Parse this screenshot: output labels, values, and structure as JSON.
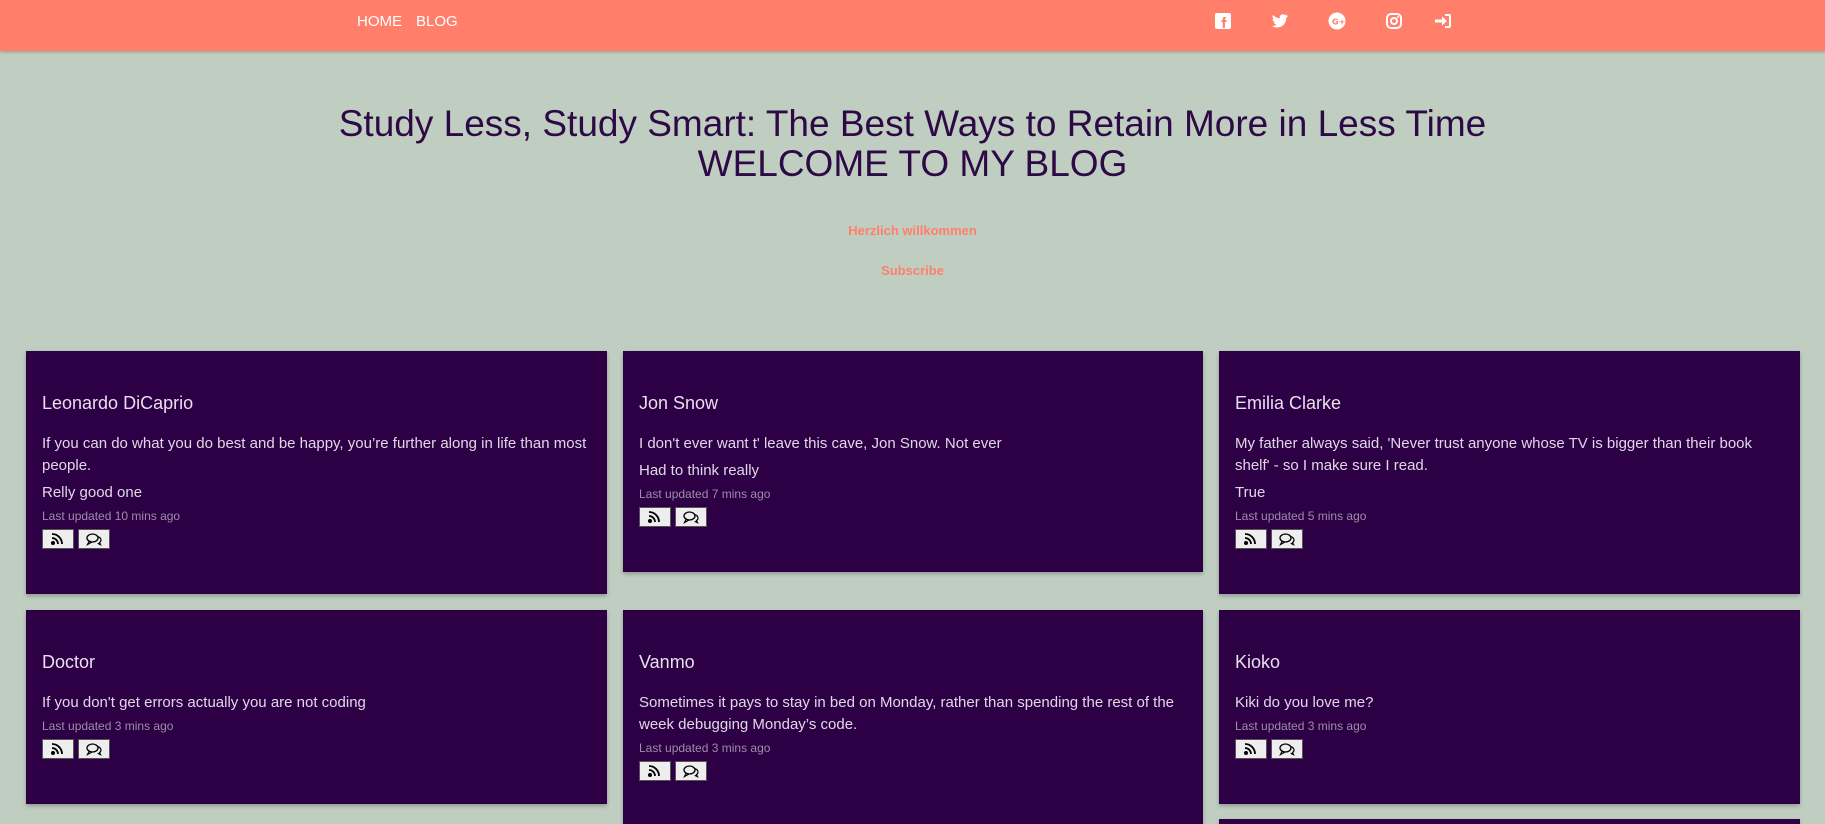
{
  "nav": {
    "links": [
      "HOME",
      "BLOG"
    ],
    "icons": [
      "facebook-icon",
      "twitter-icon",
      "google-plus-icon",
      "instagram-icon",
      "sign-in-icon"
    ]
  },
  "hero": {
    "title_line1": "Study Less, Study Smart: The Best Ways to Retain More in Less Time",
    "title_line2": "WELCOME TO MY BLOG",
    "greeting": "Herzlich willkommen",
    "subscribe": "Subscribe"
  },
  "posts": [
    {
      "title": "Leonardo DiCaprio",
      "text": "If you can do what you do best and be happy, you’re further along in life than most people.",
      "comment": "Relly good one",
      "updated": "Last updated 10 mins ago"
    },
    {
      "title": "Jon Snow",
      "text": "I don't ever want t' leave this cave, Jon Snow. Not ever",
      "comment": "Had to think really",
      "updated": "Last updated 7 mins ago"
    },
    {
      "title": "Emilia Clarke",
      "text": "My father always said, 'Never trust anyone whose TV is bigger than their book shelf' - so I make sure I read.",
      "comment": "True",
      "updated": "Last updated 5 mins ago"
    },
    {
      "title": "Doctor",
      "text": "If you don't get errors actually you are not coding",
      "comment": "",
      "updated": "Last updated 3 mins ago"
    },
    {
      "title": "Vanmo",
      "text": "Sometimes it pays to stay in bed on Monday, rather than spending the rest of the week debugging Monday’s code.",
      "comment": "",
      "updated": "Last updated 3 mins ago"
    },
    {
      "title": "Kioko",
      "text": "Kiki do you love me?",
      "comment": "",
      "updated": "Last updated 3 mins ago"
    }
  ],
  "colors": {
    "navbar": "#ff7f6a",
    "background": "#c0cec2",
    "card": "#2d0045",
    "title": "#2d0a45",
    "accent": "#ff7f6a"
  }
}
